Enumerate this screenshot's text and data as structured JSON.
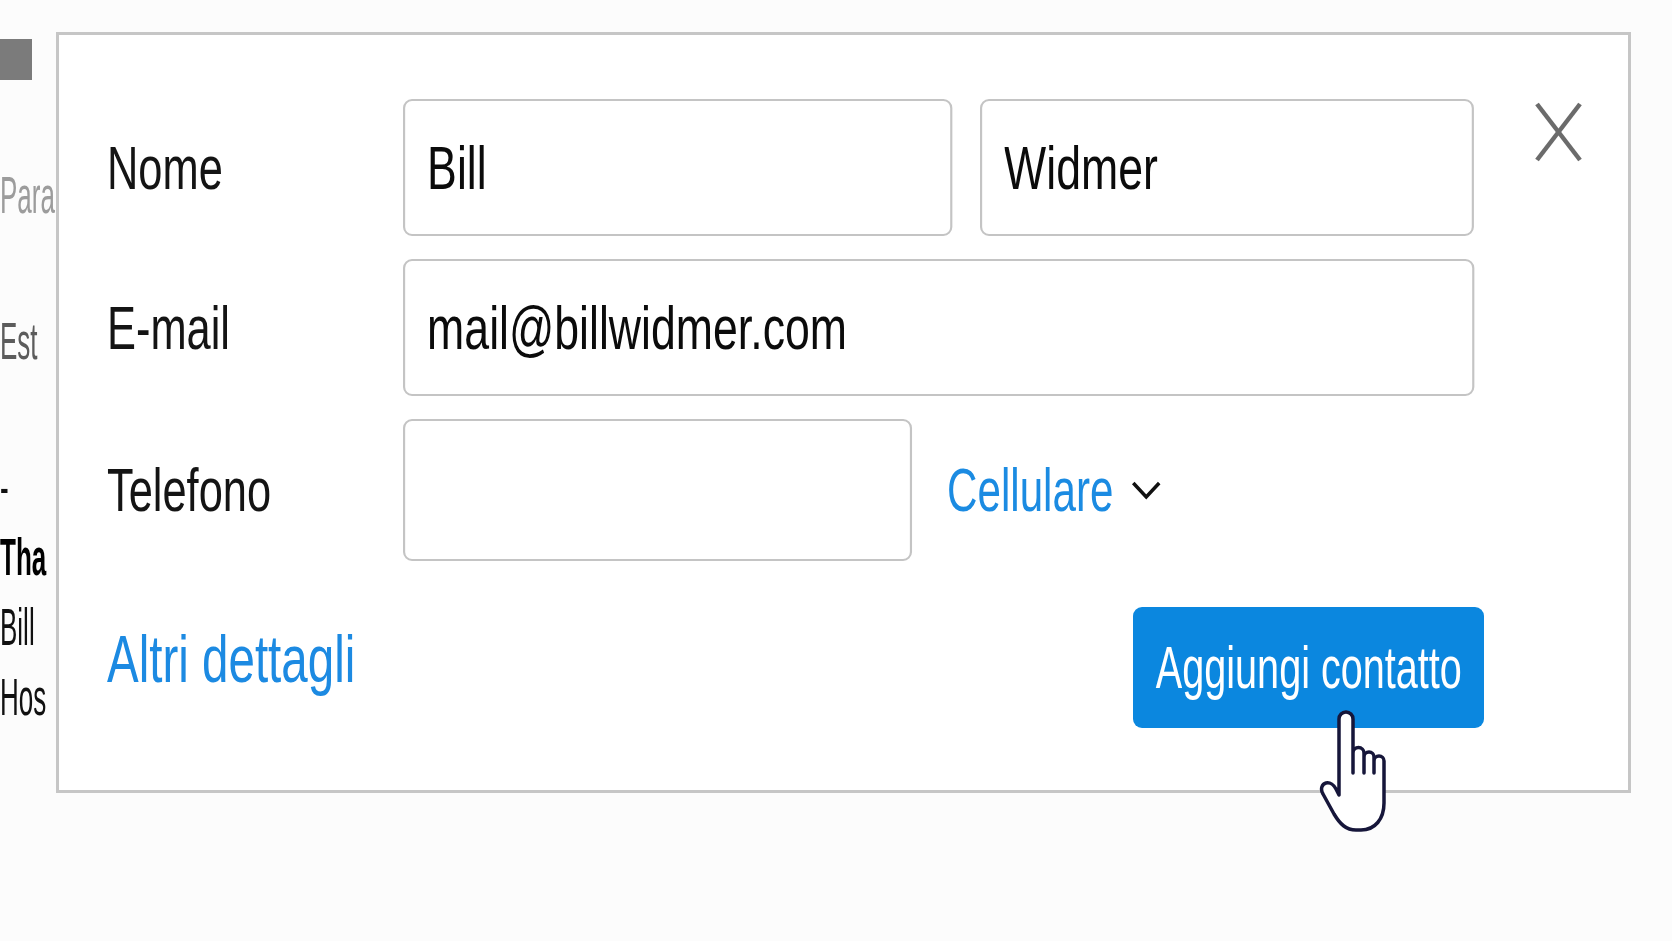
{
  "background_page": {
    "paragraphs": [
      {
        "lines": [
          {
            "text": "Para",
            "kind": "muted"
          }
        ]
      },
      {
        "lines": [
          {
            "text": "Est",
            "kind": "subtle"
          }
        ]
      },
      {
        "lines": [
          {
            "text": "-",
            "kind": "plain"
          },
          {
            "text": "Tha",
            "kind": "bold"
          },
          {
            "text": "Bill",
            "kind": "plain"
          },
          {
            "text": "Hos",
            "kind": "plain"
          }
        ]
      }
    ]
  },
  "dialog": {
    "form": {
      "name": {
        "label": "Nome",
        "first_name": "Bill",
        "last_name": "Widmer"
      },
      "email": {
        "label": "E-mail",
        "value": "mail@billwidmer.com"
      },
      "phone": {
        "label": "Telefono",
        "type": "Cellulare"
      }
    },
    "more_details_link": "Altri dettagli",
    "submit_button": "Aggiungi contatto"
  }
}
